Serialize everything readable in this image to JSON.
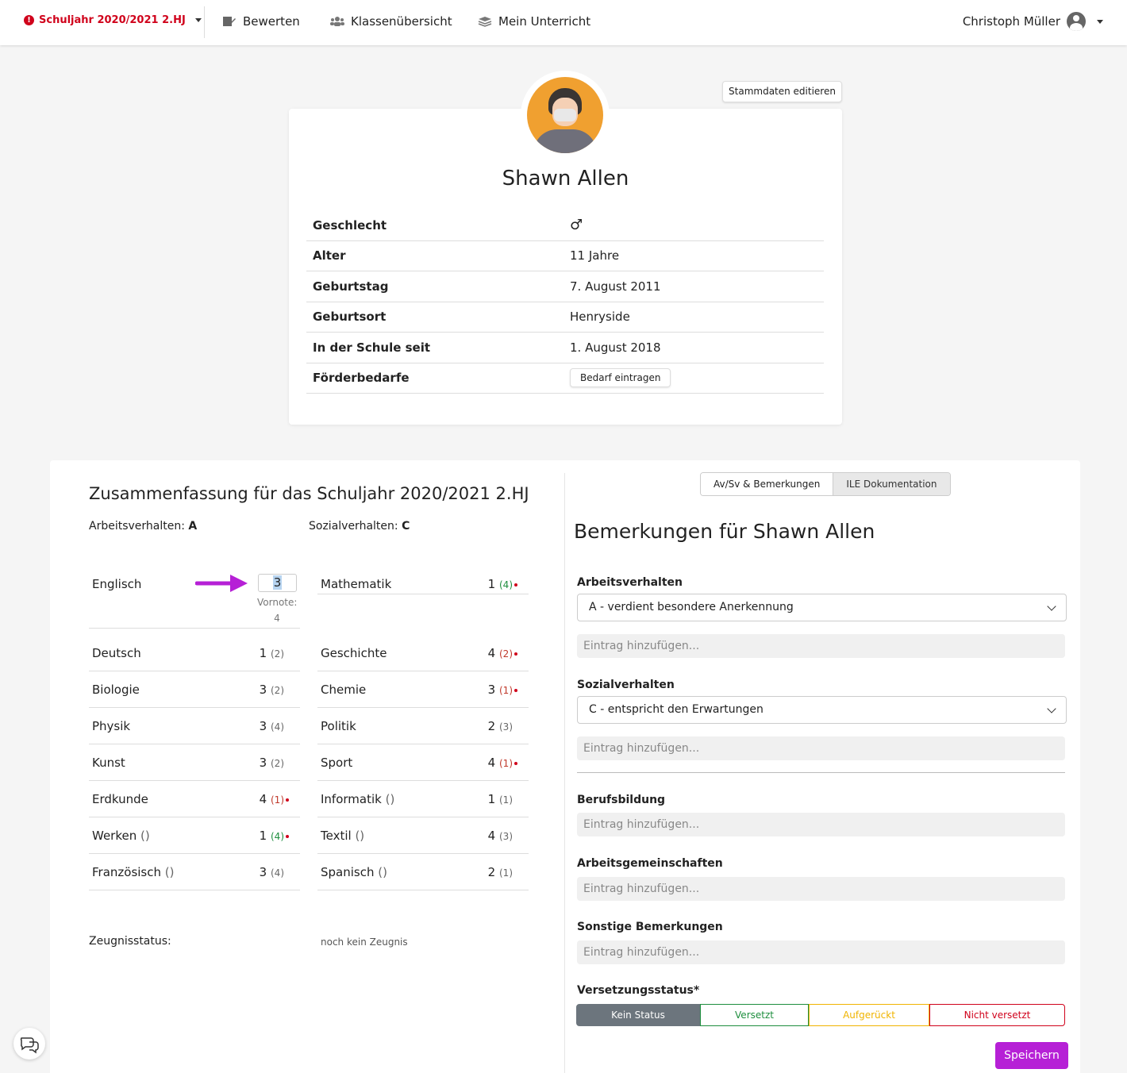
{
  "navbar": {
    "year_label": "Schuljahr 2020/2021 2.HJ",
    "items": [
      {
        "label": "Bewerten",
        "icon": "pen-icon"
      },
      {
        "label": "Klassenübersicht",
        "icon": "users-icon"
      },
      {
        "label": "Mein Unterricht",
        "icon": "layers-icon"
      }
    ],
    "user_name": "Christoph Müller"
  },
  "profile": {
    "edit_label": "Stammdaten editieren",
    "name": "Shawn Allen",
    "rows": [
      {
        "label": "Geschlecht",
        "value": "♂"
      },
      {
        "label": "Alter",
        "value": "11 Jahre"
      },
      {
        "label": "Geburtstag",
        "value": "7. August 2011"
      },
      {
        "label": "Geburtsort",
        "value": "Henryside"
      },
      {
        "label": "In der Schule seit",
        "value": "1. August 2018"
      },
      {
        "label": "Förderbedarfe",
        "button": "Bedarf eintragen"
      }
    ]
  },
  "summary": {
    "title": "Zusammenfassung für das Schuljahr 2020/2021 2.HJ",
    "arbeitsverhalten_label": "Arbeitsverhalten:",
    "arbeitsverhalten_value": "A",
    "sozialverhalten_label": "Sozialverhalten:",
    "sozialverhalten_value": "C",
    "english": {
      "subject": "Englisch",
      "input_value": "3",
      "vornote_label": "Vornote:",
      "vornote_value": "4"
    },
    "left": [
      {
        "subject": "Deutsch",
        "paren": "",
        "grade": "1",
        "prev": "(2)",
        "prev_color": "grey",
        "dot": false
      },
      {
        "subject": "Biologie",
        "paren": "",
        "grade": "3",
        "prev": "(2)",
        "prev_color": "grey",
        "dot": false
      },
      {
        "subject": "Physik",
        "paren": "",
        "grade": "3",
        "prev": "(4)",
        "prev_color": "grey",
        "dot": false
      },
      {
        "subject": "Kunst",
        "paren": "",
        "grade": "3",
        "prev": "(2)",
        "prev_color": "grey",
        "dot": false
      },
      {
        "subject": "Erdkunde",
        "paren": "",
        "grade": "4",
        "prev": "(1)",
        "prev_color": "red",
        "dot": true
      },
      {
        "subject": "Werken",
        "paren": "()",
        "grade": "1",
        "prev": "(4)",
        "prev_color": "green",
        "dot": true
      },
      {
        "subject": "Französisch",
        "paren": "()",
        "grade": "3",
        "prev": "(4)",
        "prev_color": "grey",
        "dot": false
      }
    ],
    "right": [
      {
        "subject": "Mathematik",
        "paren": "",
        "grade": "1",
        "prev": "(4)",
        "prev_color": "green",
        "dot": true
      },
      {
        "subject": "Geschichte",
        "paren": "",
        "grade": "4",
        "prev": "(2)",
        "prev_color": "red",
        "dot": true
      },
      {
        "subject": "Chemie",
        "paren": "",
        "grade": "3",
        "prev": "(1)",
        "prev_color": "red",
        "dot": true
      },
      {
        "subject": "Politik",
        "paren": "",
        "grade": "2",
        "prev": "(3)",
        "prev_color": "grey",
        "dot": false
      },
      {
        "subject": "Sport",
        "paren": "",
        "grade": "4",
        "prev": "(1)",
        "prev_color": "red",
        "dot": true
      },
      {
        "subject": "Informatik",
        "paren": "()",
        "grade": "1",
        "prev": "(1)",
        "prev_color": "grey",
        "dot": false
      },
      {
        "subject": "Textil",
        "paren": "()",
        "grade": "4",
        "prev": "(3)",
        "prev_color": "grey",
        "dot": false
      },
      {
        "subject": "Spanisch",
        "paren": "()",
        "grade": "2",
        "prev": "(1)",
        "prev_color": "grey",
        "dot": false
      }
    ],
    "zeugnis_label": "Zeugnisstatus:",
    "zeugnis_value": "noch kein Zeugnis"
  },
  "remarks": {
    "tabs": [
      "Av/Sv & Bemerkungen",
      "ILE Dokumentation"
    ],
    "title": "Bemerkungen für Shawn Allen",
    "arbeitsverhalten_label": "Arbeitsverhalten",
    "arbeitsverhalten_select": "A - verdient besondere Anerkennung",
    "sozialverhalten_label": "Sozialverhalten",
    "sozialverhalten_select": "C - entspricht den Erwartungen",
    "berufsbildung_label": "Berufsbildung",
    "arbeitsgemeinschaften_label": "Arbeitsgemeinschaften",
    "sonstige_label": "Sonstige Bemerkungen",
    "entry_placeholder": "Eintrag hinzufügen...",
    "versetzung_label": "Versetzungsstatus*",
    "status_options": [
      "Kein Status",
      "Versetzt",
      "Aufgerückt",
      "Nicht versetzt"
    ],
    "save_label": "Speichern"
  },
  "colors": {
    "accent": "#b620d6",
    "alert": "#d0021b",
    "green": "#1e8e3e",
    "yellow": "#f0b400"
  }
}
